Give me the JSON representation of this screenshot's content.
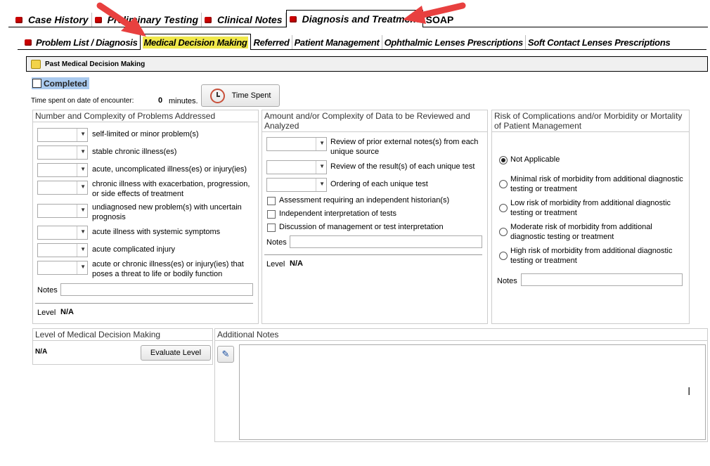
{
  "main_tabs": [
    {
      "label": "Case History"
    },
    {
      "label": "Preliminary Testing"
    },
    {
      "label": "Clinical Notes"
    },
    {
      "label": "Diagnosis and Treatment",
      "active": true
    },
    {
      "label": "SOAP"
    }
  ],
  "sub_tabs": [
    {
      "label": "Problem List / Diagnosis"
    },
    {
      "label": "Medical Decision Making",
      "active": true
    },
    {
      "label": "Referred"
    },
    {
      "label": "Patient Management"
    },
    {
      "label": "Ophthalmic Lenses Prescriptions"
    },
    {
      "label": "Soft Contact Lenses Prescriptions"
    }
  ],
  "colors": {
    "active_subtab": "#f0e84a",
    "tab_dot": "#cc0000",
    "arrow": "#e8403f",
    "completed_bg": "#a9c9ee"
  },
  "past_header": "Past Medical Decision Making",
  "completed_label": "Completed",
  "time": {
    "label": "Time spent on date of encounter:",
    "value": "0",
    "unit": "minutes.",
    "button": "Time Spent"
  },
  "problems": {
    "title": "Number and Complexity of Problems Addressed",
    "items": [
      "self-limited or minor problem(s)",
      "stable chronic illness(es)",
      "acute, uncomplicated illness(es) or injury(ies)",
      "chronic illness with exacerbation, progression, or side effects of treatment",
      "undiagnosed new problem(s) with uncertain prognosis",
      "acute illness with systemic symptoms",
      "acute complicated injury",
      "acute or chronic illness(es) or injury(ies) that poses a threat to life or bodily function"
    ],
    "notes_label": "Notes",
    "level_label": "Level",
    "level_value": "N/A"
  },
  "data": {
    "title": "Amount and/or Complexity of Data to be Reviewed and Analyzed",
    "selects": [
      "Review of prior external notes(s) from each unique source",
      "Review of the result(s) of each unique test",
      "Ordering of each unique test"
    ],
    "checks": [
      "Assessment requiring an independent historian(s)",
      "Independent interpretation of tests",
      "Discussion of management or test interpretation"
    ],
    "notes_label": "Notes",
    "level_label": "Level",
    "level_value": "N/A"
  },
  "risk": {
    "title": "Risk of Complications and/or Morbidity or Mortality of Patient Management",
    "options": [
      "Not Applicable",
      "Minimal risk of morbidity from additional diagnostic testing or treatment",
      "Low risk of morbidity from additional diagnostic testing or treatment",
      "Moderate risk of morbidity from additional diagnostic testing or treatment",
      "High risk of morbidity from additional diagnostic testing or treatment"
    ],
    "selected": 0,
    "notes_label": "Notes"
  },
  "level_mdm": {
    "title": "Level of Medical Decision Making",
    "value": "N/A",
    "button": "Evaluate Level"
  },
  "additional_notes": {
    "title": "Additional Notes"
  }
}
